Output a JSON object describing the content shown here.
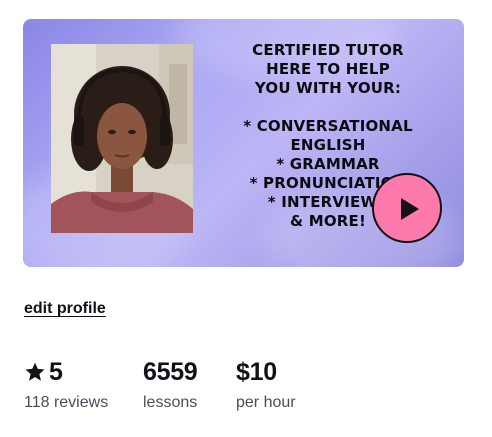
{
  "video": {
    "promo_text": "CERTIFIED TUTOR\nHERE TO HELP\nYOU WITH YOUR:\n\n* CONVERSATIONAL\nENGLISH\n* GRAMMAR\n* PRONUNCIATION\n* INTERVIEWS\n& MORE!",
    "play_icon": "play-icon",
    "accent_color": "#ff7aac",
    "background_color": "#aaa6f3"
  },
  "profile": {
    "edit_label": "edit profile"
  },
  "stats": {
    "rating": {
      "value": "5",
      "label": "118 reviews",
      "icon": "star-icon"
    },
    "lessons": {
      "value": "6559",
      "label": "lessons"
    },
    "price": {
      "value": "$10",
      "label": "per hour"
    }
  }
}
